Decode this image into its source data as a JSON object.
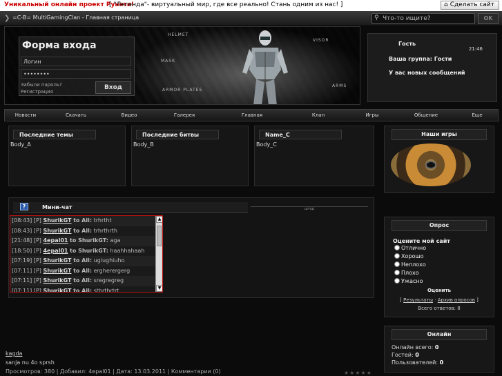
{
  "topbar": {
    "promo": "Уникальный онлайн проект Рунета!",
    "legend": "[ \"Легенда\"- виртуальный мир, где все реально! Стань одним из нас! ]",
    "make_home": "Сделать сайт"
  },
  "header": {
    "site_title": "=C-B= MultiGamingClan - Главная страница",
    "search_placeholder": "Что-то ищите?",
    "ok_label": "OK"
  },
  "hero_labels": [
    "HELMET",
    "VISOR",
    "MASK",
    "ARMOR PLATES",
    "ARMS"
  ],
  "login": {
    "title": "Форма входа",
    "login_placeholder": "Логин",
    "password_value": "••••••••",
    "forgot": "Забыли пароль?",
    "register": "Регистрация",
    "submit": "Вход"
  },
  "user": {
    "name": "Гость",
    "time": "21:46",
    "group": "Ваша группа: Гости",
    "messages": "У вас новых сообщений"
  },
  "nav": [
    "Новости",
    "Скачать",
    "Видео",
    "Галерея",
    "Главная",
    "Клан",
    "Игры",
    "Общение",
    "Еще"
  ],
  "panels": [
    {
      "title": "Последние темы",
      "body": "Body_A"
    },
    {
      "title": "Последние битвы",
      "body": "Body_B"
    },
    {
      "title": "Name_C",
      "body": "Body_C"
    }
  ],
  "minichat": {
    "title": "Мини-чат",
    "right_label": "штод",
    "help_icon": "?",
    "messages": [
      {
        "time": "[08:43]",
        "tag": "[P]",
        "nick": "ShurikGT",
        "to": "to All:",
        "text": "trhrtht"
      },
      {
        "time": "[08:43]",
        "tag": "[P]",
        "nick": "ShurikGT",
        "to": "to All:",
        "text": "trhrthrth"
      },
      {
        "time": "[21:48]",
        "tag": "[P]",
        "nick": "4epal01",
        "to": "to ShurikGT:",
        "text": "aga"
      },
      {
        "time": "[18:50]",
        "tag": "[P]",
        "nick": "4epal01",
        "to": "to ShurikGT:",
        "text": "haahhahaah"
      },
      {
        "time": "[07:19]",
        "tag": "[P]",
        "nick": "ShurikGT",
        "to": "to All:",
        "text": "ugiughiuho"
      },
      {
        "time": "[07:11]",
        "tag": "[P]",
        "nick": "ShurikGT",
        "to": "to All:",
        "text": "ergherergerg"
      },
      {
        "time": "[07:11]",
        "tag": "[P]",
        "nick": "ShurikGT",
        "to": "to All:",
        "text": "sregregreg"
      },
      {
        "time": "[07:11]",
        "tag": "[P]",
        "nick": "ShurikGT",
        "to": "to All:",
        "text": "sthrthrtrt"
      }
    ]
  },
  "our_games": {
    "title": "Наши игры"
  },
  "poll": {
    "title": "Опрос",
    "question": "Оцените мой сайт",
    "options": [
      "Отлично",
      "Хорошо",
      "Неплохо",
      "Плохо",
      "Ужасно"
    ],
    "vote": "Оценить",
    "results": "Результаты",
    "separator": "·",
    "archive": "Архив опросов",
    "total": "Всего ответов: 8"
  },
  "online": {
    "title": "Онлайн",
    "rows": [
      {
        "label": "Онлайн всего:",
        "value": "0"
      },
      {
        "label": "Гостей:",
        "value": "0"
      },
      {
        "label": "Пользователей:",
        "value": "0"
      }
    ]
  },
  "news": {
    "title": "kagda",
    "text": "sanja nu 4o sprsh",
    "meta": "Просмотров: 380 | Добавил: 4epal01 | Дата: 13.03.2011 | Комментарии (0)"
  }
}
